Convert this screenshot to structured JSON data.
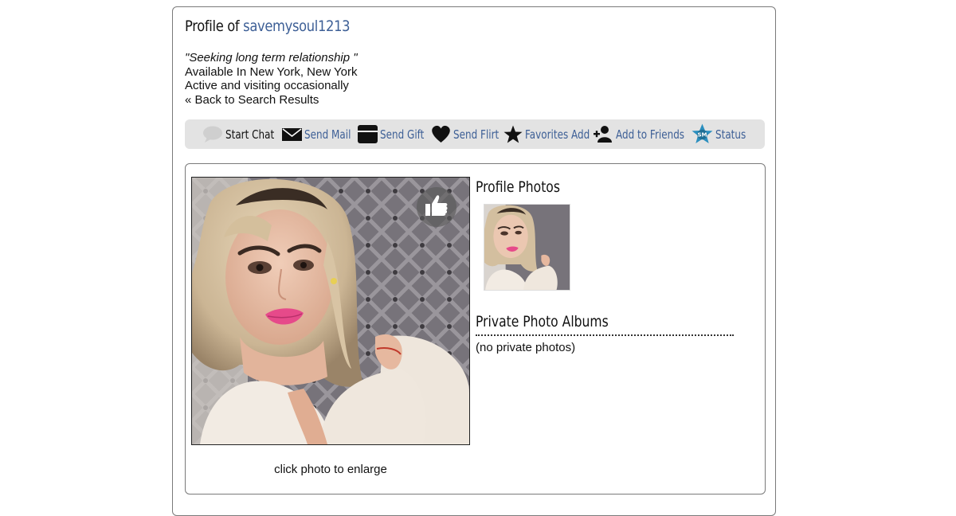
{
  "profile": {
    "title_prefix": "Profile of",
    "username": "savemysoul1213",
    "tagline": "\"Seeking long term relationship \"",
    "location": "Available In New York, New York",
    "activity": "Active and visiting occasionally",
    "back_link": "« Back to Search Results"
  },
  "actions": [
    {
      "label": "Start Chat",
      "icon": "chat-bubble-icon"
    },
    {
      "label": "Send Mail",
      "icon": "envelope-icon"
    },
    {
      "label": "Send Gift",
      "icon": "gift-box-icon"
    },
    {
      "label": "Send Flirt",
      "icon": "heart-icon"
    },
    {
      "label": "Favorites Add",
      "icon": "star-icon"
    },
    {
      "label": "Add to Friends",
      "icon": "add-friend-icon"
    },
    {
      "label": "Status",
      "icon": "sm-star-badge-icon",
      "badge_text": "SM"
    }
  ],
  "photo": {
    "caption": "click photo to enlarge",
    "like_icon": "thumbs-up-icon"
  },
  "sections": {
    "profile_photos": "Profile Photos",
    "private_albums": "Private Photo Albums",
    "no_private": "(no private photos)"
  },
  "colors": {
    "link": "#3d5f96",
    "actionbar_bg": "#e3e3e3",
    "status_badge": "#2b8fbf",
    "lips": "#e64a8a"
  }
}
